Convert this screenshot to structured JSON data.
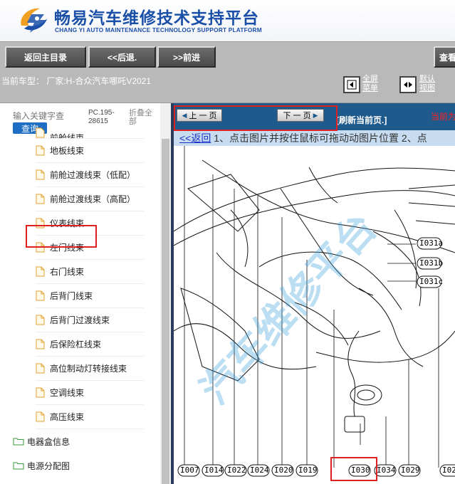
{
  "header": {
    "title": "畅易汽车维修技术支持平台",
    "subtitle": "CHANG YI AUTO MAINTENANCE TECHNOLOGY SUPPORT PLATFORM"
  },
  "toolbar": {
    "home_label": "返回主目录",
    "back_label": "<<后退.",
    "forward_label": ">>前进",
    "view_label": "查看"
  },
  "infobar": {
    "car_model": "当前车型：  厂家:H-合众汽车哪吒V2021",
    "fullscreen_label": "全屏菜单",
    "default_view_label": "默认视图"
  },
  "sidebar": {
    "search_placeholder": "输入关键字查",
    "search_button": "查询",
    "pc_code": "PC.195-28615",
    "collapse_all": "折叠全部",
    "top_cut_item": "前舱线束",
    "items": [
      {
        "label": "地板线束"
      },
      {
        "label": "前舱过渡线束（低配）"
      },
      {
        "label": "前舱过渡线束（高配）"
      },
      {
        "label": "仪表线束"
      },
      {
        "label": "左门线束"
      },
      {
        "label": "右门线束"
      },
      {
        "label": "后背门线束"
      },
      {
        "label": "后背门过渡线束"
      },
      {
        "label": "后保险杠线束"
      },
      {
        "label": "高位制动灯转接线束"
      },
      {
        "label": "空调线束"
      },
      {
        "label": "高压线束"
      }
    ],
    "folders": [
      {
        "label": "电器盒信息"
      },
      {
        "label": "电源分配图"
      }
    ],
    "selected_index": 3
  },
  "viewer": {
    "prev_page": "上 一 页",
    "next_page": "下 一 页",
    "refresh": "[刷新当前页.]",
    "current_tag": "当前为",
    "back_link": "<<返回",
    "instructions": " 1、点击图片并按住鼠标可拖动动图片位置 2、点",
    "watermark": "汽车维修平台",
    "side_connectors": [
      "I031a",
      "I031b",
      "I031c"
    ],
    "bottom_connectors": [
      "I007",
      "I014",
      "I022",
      "I024",
      "I020",
      "I019",
      "I030",
      "I034",
      "I029",
      "I02"
    ],
    "highlighted_connector": "I030"
  },
  "colors": {
    "brand": "#1a4fa8",
    "toolbar": "#b9b9b9",
    "nav_strip": "#1f5a8c",
    "highlight": "#e02020",
    "search_button": "#1e6fc4"
  }
}
